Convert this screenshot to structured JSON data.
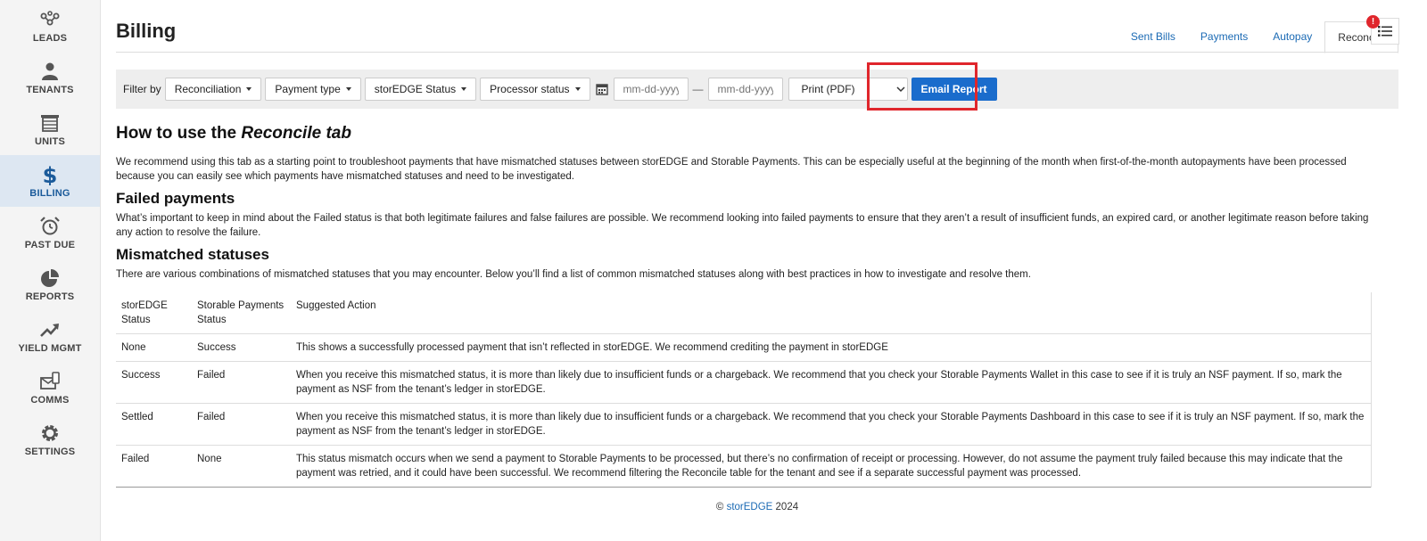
{
  "sidebar": {
    "items": [
      {
        "label": "LEADS",
        "icon": "leads-icon"
      },
      {
        "label": "TENANTS",
        "icon": "tenants-icon"
      },
      {
        "label": "UNITS",
        "icon": "units-icon"
      },
      {
        "label": "BILLING",
        "icon": "dollar-icon",
        "active": true
      },
      {
        "label": "PAST DUE",
        "icon": "alarm-clock-icon"
      },
      {
        "label": "REPORTS",
        "icon": "pie-chart-icon"
      },
      {
        "label": "YIELD MGMT",
        "icon": "trend-up-icon"
      },
      {
        "label": "COMMS",
        "icon": "envelope-phone-icon"
      },
      {
        "label": "SETTINGS",
        "icon": "gear-icon"
      }
    ]
  },
  "header": {
    "title": "Billing",
    "tabs": [
      "Sent Bills",
      "Payments",
      "Autopay",
      "Reconcile"
    ],
    "active_tab": "Reconcile"
  },
  "notification": {
    "badge": "!"
  },
  "filters": {
    "label": "Filter by",
    "dropdowns": [
      "Reconciliation",
      "Payment type",
      "storEDGE Status",
      "Processor status"
    ],
    "date_from_placeholder": "mm-dd-yyyy",
    "date_to_placeholder": "mm-dd-yyyy",
    "date_separator": "—",
    "print_value": "Print (PDF)",
    "email_button": "Email Report"
  },
  "content": {
    "how_to_prefix": "How to use the ",
    "how_to_emph": "Reconcile tab",
    "intro": "We recommend using this tab as a starting point to troubleshoot payments that have mismatched statuses between storEDGE and Storable Payments. This can be especially useful at the beginning of the month when first-of-the-month autopayments have been processed because you can easily see which payments have mismatched statuses and need to be investigated.",
    "failed_heading": "Failed payments",
    "failed_text": "What’s important to keep in mind about the Failed status is that both legitimate failures and false failures are possible. We recommend looking into failed payments to ensure that they aren’t a result of insufficient funds, an expired card, or another legitimate reason before taking any action to resolve the failure.",
    "mismatch_heading": "Mismatched statuses",
    "mismatch_text": "There are various combinations of mismatched statuses that you may encounter. Below you’ll find a list of common mismatched statuses along with best practices in how to investigate and resolve them."
  },
  "table": {
    "headers": [
      "storEDGE Status",
      "Storable Payments Status",
      "Suggested Action"
    ],
    "rows": [
      [
        "None",
        "Success",
        "This shows a successfully processed payment that isn’t reflected in storEDGE. We recommend crediting the payment in storEDGE"
      ],
      [
        "Success",
        "Failed",
        "When you receive this mismatched status, it is more than likely due to insufficient funds or a chargeback. We recommend that you check your Storable Payments Wallet in this case to see if it is truly an NSF payment. If so, mark the payment as NSF from the tenant’s ledger in storEDGE."
      ],
      [
        "Settled",
        "Failed",
        "When you receive this mismatched status, it is more than likely due to insufficient funds or a chargeback. We recommend that you check your Storable Payments Dashboard in this case to see if it is truly an NSF payment. If so, mark the payment as NSF from the tenant’s ledger in storEDGE."
      ],
      [
        "Failed",
        "None",
        "This status mismatch occurs when we send a payment to Storable Payments to be processed, but there’s no confirmation of receipt or processing. However, do not assume the payment truly failed because this may indicate that the payment was retried, and it could have been successful. We recommend filtering the Reconcile table for the tenant and see if a separate successful payment was processed."
      ]
    ]
  },
  "footer": {
    "copyright": "©",
    "brand": "storEDGE",
    "year": "2024"
  }
}
